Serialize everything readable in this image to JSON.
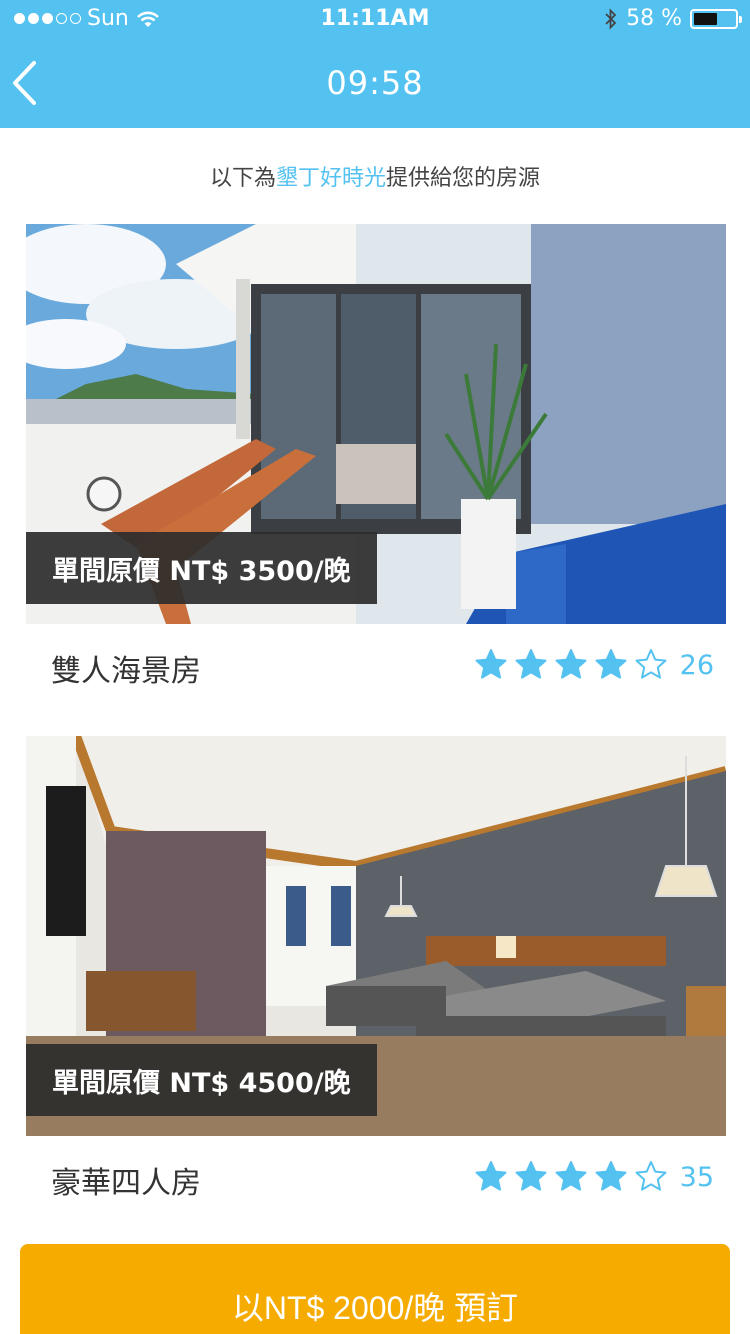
{
  "status_bar": {
    "carrier": "Sun",
    "time": "11:11AM",
    "battery_percent": "58 %",
    "battery_level": 0.58,
    "signal_bars_filled": 3,
    "signal_bars_total": 5
  },
  "nav": {
    "title": "09:58",
    "back_icon": "chevron-left-icon"
  },
  "intro": {
    "prefix": "以下為",
    "host": "墾丁好時光",
    "suffix": "提供給您的房源"
  },
  "rooms": [
    {
      "price_label": "單間原價 NT$ 3500/晚",
      "name": "雙人海景房",
      "rating": 4,
      "max_rating": 5,
      "reviews": "26"
    },
    {
      "price_label": "單間原價 NT$ 4500/晚",
      "name": "豪華四人房",
      "rating": 4,
      "max_rating": 5,
      "reviews": "35"
    }
  ],
  "book_button": {
    "label": "以NT$ 2000/晚 預訂"
  },
  "colors": {
    "accent": "#54c2f0",
    "book_button": "#f5ab00",
    "price_tag_bg": "#2c2c2c"
  }
}
